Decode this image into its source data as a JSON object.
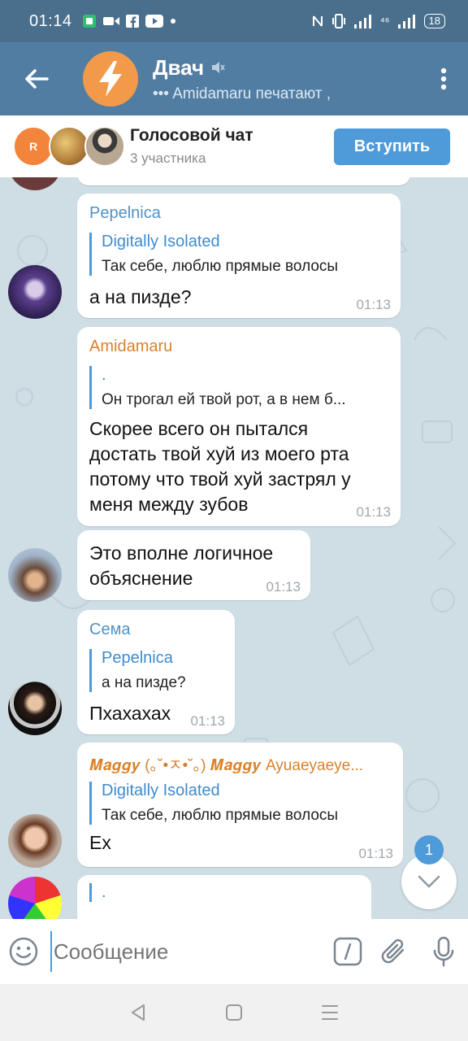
{
  "status_bar": {
    "time": "01:14",
    "network": "⁴⁶",
    "battery": "18"
  },
  "header": {
    "title": "Двач",
    "subtitle": "Amidamaru печатают ,"
  },
  "voice_chat": {
    "avatar_letter": "R",
    "title": "Голосовой чат",
    "participants": "3 участника",
    "join_label": "Вступить"
  },
  "messages": [
    {
      "author": "Pepelnica",
      "author_color": "#5192c6",
      "reply_author": "Digitally Isolated",
      "reply_text": "Так себе, люблю прямые волосы",
      "text": "а на пизде?",
      "time": "01:13"
    },
    {
      "author": "Amidamaru",
      "author_color": "#d9822b",
      "reply_author": ".",
      "reply_text": "Он трогал ей твой рот, а в нем б...",
      "text_lines": [
        "Скорее всего он пытался",
        "достать твой хуй из моего рта",
        "потому что твой хуй застрял у",
        "меня между зубов"
      ],
      "time": "01:13"
    },
    {
      "text_lines": [
        "Это вполне логичное",
        "объяснение"
      ],
      "time": "01:13"
    },
    {
      "author": "Сема",
      "author_color": "#5192c6",
      "reply_author": "Pepelnica",
      "reply_text": "а на пизде?",
      "text": "Пхахахах",
      "time": "01:13"
    },
    {
      "author": "𝑴𝒂𝒈𝒈𝒚 (｡˘•ㅈ•˘｡) 𝑴𝒂𝒈𝒈𝒚 Ayuaeyaeye...",
      "author_color": "#d9822b",
      "reply_author": "Digitally Isolated",
      "reply_text": "Так себе, люблю прямые волосы",
      "text": "Ex",
      "time": "01:13"
    },
    {
      "reply_author": "."
    }
  ],
  "scroll": {
    "unread_count": "1"
  },
  "input": {
    "placeholder": "Сообщение"
  },
  "colors": {
    "header_bg": "#517da2",
    "status_bg": "#4a6f8c",
    "accent": "#4f9ad8",
    "orange_name": "#d9822b"
  }
}
